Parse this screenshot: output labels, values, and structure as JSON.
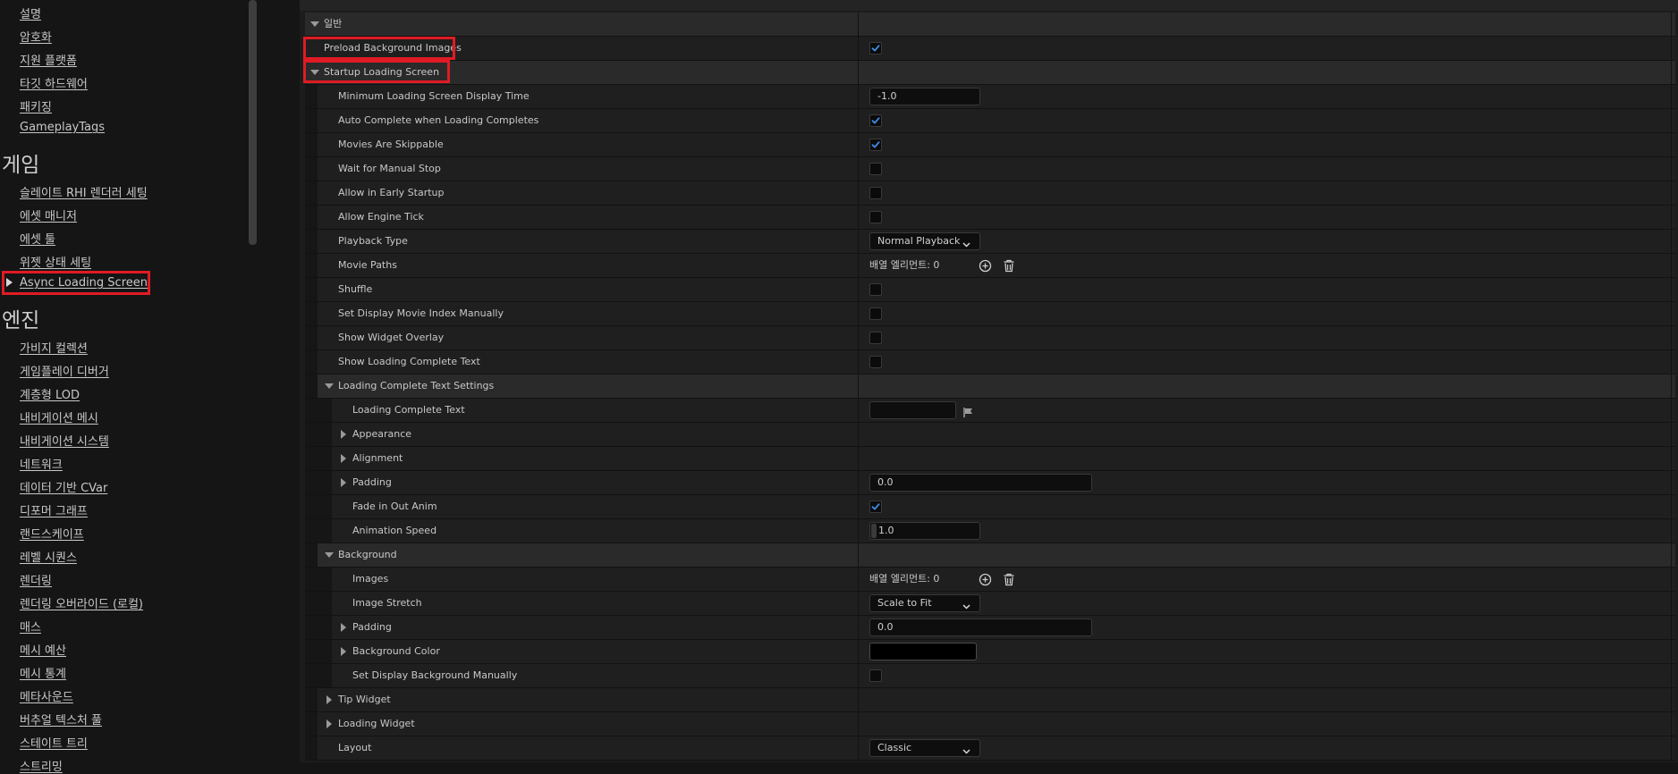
{
  "sidebar": {
    "project_links": [
      "설명",
      "암호화",
      "지원 플랫폼",
      "타깃 하드웨어",
      "패키징",
      "GameplayTags"
    ],
    "game_heading": "게임",
    "game_links": [
      "슬레이트 RHI 렌더러 세팅",
      "에셋 매니저",
      "에셋 툴",
      "위젯 상태 세팅",
      "Async Loading Screen"
    ],
    "engine_heading": "엔진",
    "engine_links": [
      "가비지 컬렉션",
      "게임플레이 디버거",
      "계층형 LOD",
      "내비게이션 메시",
      "내비게이션 시스템",
      "네트워크",
      "데이터 기반 CVar",
      "디포머 그래프",
      "랜드스케이프",
      "레벨 시퀀스",
      "렌더링",
      "렌더링 오버라이드 (로컬)",
      "매스",
      "메시 예산",
      "메시 통계",
      "메타사운드",
      "버추얼 텍스처 풀",
      "스테이트 트리",
      "스트리밍"
    ]
  },
  "rows": [
    {
      "label": "일반",
      "level": 0,
      "expander": "down",
      "type": "category"
    },
    {
      "label": "Preload Background Images",
      "level": 0,
      "expander": "none",
      "type": "checkbox",
      "checked": true
    },
    {
      "label": "Startup Loading Screen",
      "level": 0,
      "expander": "down",
      "type": "category"
    },
    {
      "label": "Minimum Loading Screen Display Time",
      "level": 1,
      "expander": "none",
      "type": "number",
      "value": "-1.0"
    },
    {
      "label": "Auto Complete when Loading Completes",
      "level": 1,
      "expander": "none",
      "type": "checkbox",
      "checked": true
    },
    {
      "label": "Movies Are Skippable",
      "level": 1,
      "expander": "none",
      "type": "checkbox",
      "checked": true
    },
    {
      "label": "Wait for Manual Stop",
      "level": 1,
      "expander": "none",
      "type": "checkbox",
      "checked": false
    },
    {
      "label": "Allow in Early Startup",
      "level": 1,
      "expander": "none",
      "type": "checkbox",
      "checked": false
    },
    {
      "label": "Allow Engine Tick",
      "level": 1,
      "expander": "none",
      "type": "checkbox",
      "checked": false
    },
    {
      "label": "Playback Type",
      "level": 1,
      "expander": "none",
      "type": "dropdown",
      "value": "Normal Playback"
    },
    {
      "label": "Movie Paths",
      "level": 1,
      "expander": "none",
      "type": "array",
      "value": "배열 엘리먼트: 0"
    },
    {
      "label": "Shuffle",
      "level": 1,
      "expander": "none",
      "type": "checkbox",
      "checked": false
    },
    {
      "label": "Set Display Movie Index Manually",
      "level": 1,
      "expander": "none",
      "type": "checkbox",
      "checked": false
    },
    {
      "label": "Show Widget Overlay",
      "level": 1,
      "expander": "none",
      "type": "checkbox",
      "checked": false
    },
    {
      "label": "Show Loading Complete Text",
      "level": 1,
      "expander": "none",
      "type": "checkbox",
      "checked": false
    },
    {
      "label": "Loading Complete Text Settings",
      "level": 1,
      "expander": "down",
      "type": "category"
    },
    {
      "label": "Loading Complete Text",
      "level": 2,
      "expander": "none",
      "type": "text",
      "value": ""
    },
    {
      "label": "Appearance",
      "level": 2,
      "expander": "right",
      "type": "category"
    },
    {
      "label": "Alignment",
      "level": 2,
      "expander": "right",
      "type": "category"
    },
    {
      "label": "Padding",
      "level": 2,
      "expander": "right",
      "type": "wide-number",
      "value": "0.0"
    },
    {
      "label": "Fade in Out Anim",
      "level": 2,
      "expander": "none",
      "type": "checkbox",
      "checked": true
    },
    {
      "label": "Animation Speed",
      "level": 2,
      "expander": "none",
      "type": "number",
      "value": "1.0"
    },
    {
      "label": "Background",
      "level": 1,
      "expander": "down",
      "type": "category"
    },
    {
      "label": "Images",
      "level": 2,
      "expander": "none",
      "type": "array",
      "value": "배열 엘리먼트: 0"
    },
    {
      "label": "Image Stretch",
      "level": 2,
      "expander": "none",
      "type": "dropdown",
      "value": "Scale to Fit"
    },
    {
      "label": "Padding",
      "level": 2,
      "expander": "right",
      "type": "wide-number",
      "value": "0.0"
    },
    {
      "label": "Background Color",
      "level": 2,
      "expander": "right",
      "type": "color",
      "value": "#000000"
    },
    {
      "label": "Set Display Background Manually",
      "level": 2,
      "expander": "none",
      "type": "checkbox",
      "checked": false
    },
    {
      "label": "Tip Widget",
      "level": 1,
      "expander": "right",
      "type": "category"
    },
    {
      "label": "Loading Widget",
      "level": 1,
      "expander": "right",
      "type": "category"
    },
    {
      "label": "Layout",
      "level": 1,
      "expander": "none",
      "type": "dropdown",
      "value": "Classic"
    }
  ],
  "icons": {
    "checkmark": "check-icon",
    "add": "add-element-icon",
    "remove": "delete-trash-icon",
    "localize": "flag-icon",
    "dropdown": "chevron-down-icon",
    "expand": "triangle-icon"
  },
  "colors": {
    "highlight": "#e01b24",
    "check_blue": "#3d8eea"
  }
}
